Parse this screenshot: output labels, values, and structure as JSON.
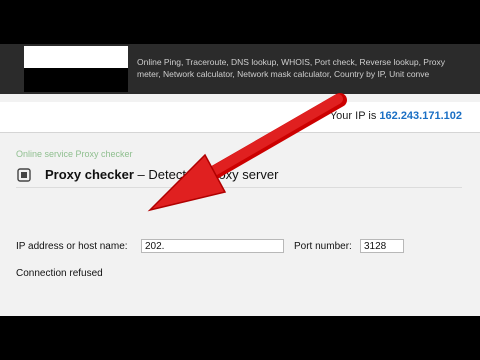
{
  "top_nav": {
    "line1": "Online Ping, Traceroute, DNS lookup, WHOIS, Port check, Reverse lookup, Proxy",
    "line2": "meter, Network calculator, Network mask calculator, Country by IP, Unit conve"
  },
  "ip_bar": {
    "label": "Your IP is",
    "value": "162.243.171.102"
  },
  "service": {
    "link_text": "Online service Proxy checker",
    "title_bold": "Proxy checker",
    "title_rest": " – Detects a proxy server",
    "icon": "tool-icon"
  },
  "form": {
    "host_label": "IP address or host name:",
    "host_value": "202.",
    "port_label": "Port number:",
    "port_value": "3128"
  },
  "result": {
    "text": "Connection refused"
  },
  "overlay": {
    "arrow_color": "#e02020"
  }
}
